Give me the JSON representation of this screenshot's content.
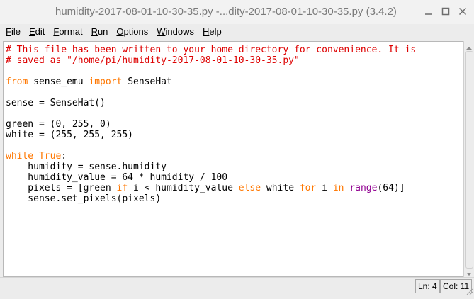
{
  "window": {
    "title": "humidity-2017-08-01-10-30-35.py -...dity-2017-08-01-10-30-35.py (3.4.2)"
  },
  "menu": {
    "items": [
      {
        "first": "F",
        "rest": "ile"
      },
      {
        "first": "E",
        "rest": "dit"
      },
      {
        "first": "F",
        "rest": "ormat"
      },
      {
        "first": "R",
        "rest": "un"
      },
      {
        "first": "O",
        "rest": "ptions"
      },
      {
        "first": "W",
        "rest": "indows"
      },
      {
        "first": "H",
        "rest": "elp"
      }
    ]
  },
  "code": {
    "comment1": "# This file has been written to your home directory for convenience. It is",
    "comment2": "# saved as \"/home/pi/humidity-2017-08-01-10-30-35.py\"",
    "from_kw": "from",
    "module": " sense_emu ",
    "import_kw": "import",
    "import_name": " SenseHat",
    "sense_line": "sense = SenseHat()",
    "green_line": "green = (0, 255, 0)",
    "white_line": "white = (255, 255, 255)",
    "while_kw": "while",
    "true_kw": " True",
    "colon": ":",
    "humidity_line": "    humidity = sense.humidity",
    "humidity_value_line": "    humidity_value = 64 * humidity / 100",
    "pixels_a": "    pixels = [green ",
    "if_kw": "if",
    "pixels_b": " i < humidity_value ",
    "else_kw": "else",
    "pixels_c": " white ",
    "for_kw": "for",
    "pixels_d": " i ",
    "in_kw": "in",
    "pixels_e": " ",
    "range_bi": "range",
    "pixels_f": "(64)]",
    "set_pixels_line": "    sense.set_pixels(pixels)"
  },
  "status": {
    "line": "Ln: 4",
    "col": "Col: 11"
  },
  "icons": {
    "minimize": "minimize-icon",
    "maximize": "maximize-icon",
    "close": "close-icon"
  },
  "colors": {
    "comment": "#dd0000",
    "keyword": "#ff7700",
    "builtin": "#900090"
  }
}
